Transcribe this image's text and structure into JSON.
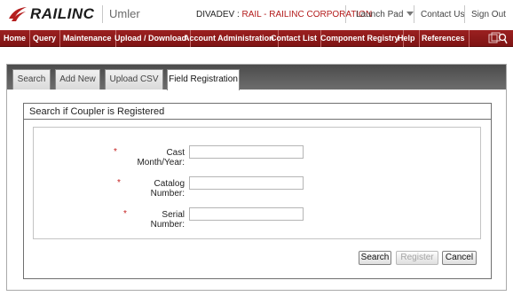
{
  "header": {
    "logo_text": "RAILINC",
    "app_name": "Umler",
    "org_code": "DIVADEV :",
    "org_name": "RAIL - RAILINC CORPORATION",
    "launch_pad": "Launch Pad",
    "contact_us": "Contact Us",
    "sign_out": "Sign Out"
  },
  "nav": {
    "items": [
      "Home",
      "Query",
      "Maintenance",
      "Upload / Download",
      "Account Administration",
      "Contact List",
      "Component Registry",
      "Help",
      "References"
    ]
  },
  "tabs": [
    "Search",
    "Add New",
    "Upload CSV",
    "Field Registration"
  ],
  "panel": {
    "title": "Search if Coupler is Registered",
    "fields": [
      {
        "label": "Cast Month/Year:",
        "value": ""
      },
      {
        "label": "Catalog Number:",
        "value": ""
      },
      {
        "label": "Serial Number:",
        "value": ""
      }
    ],
    "required_marker": "*",
    "buttons": {
      "search": "Search",
      "register": "Register",
      "cancel": "Cancel"
    }
  },
  "colors": {
    "nav_bg": "#8b1a1a",
    "required": "#c41e1e",
    "org_name": "#b31b1b"
  }
}
